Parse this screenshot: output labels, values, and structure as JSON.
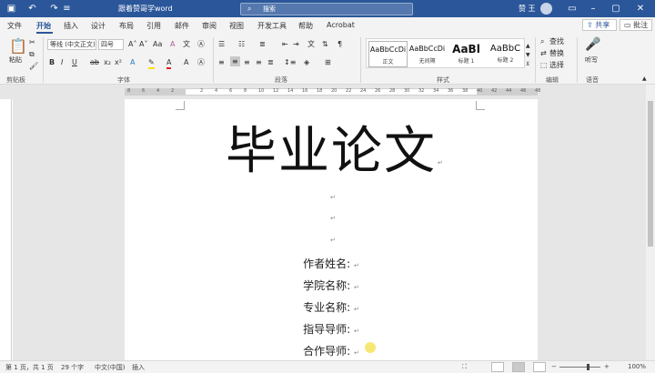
{
  "titlebar": {
    "document_title": "跟着赞哥学word",
    "search_placeholder": "搜索",
    "user_name": "赞 王"
  },
  "tabs": [
    "文件",
    "开始",
    "插入",
    "设计",
    "布局",
    "引用",
    "邮件",
    "审阅",
    "视图",
    "开发工具",
    "帮助",
    "Acrobat"
  ],
  "share_label": "共享",
  "comment_label": "批注",
  "ribbon": {
    "clipboard": {
      "paste": "粘贴",
      "group": "剪贴板"
    },
    "font": {
      "name": "等线 (中文正文)",
      "size": "四号",
      "group": "字体"
    },
    "paragraph": {
      "group": "段落"
    },
    "styles": {
      "group": "样式",
      "items": [
        {
          "preview": "AaBbCcDi",
          "name": "正文"
        },
        {
          "preview": "AaBbCcDi",
          "name": "无间隔"
        },
        {
          "preview": "AaBl",
          "name": "标题 1"
        },
        {
          "preview": "AaBbC",
          "name": "标题 2"
        }
      ]
    },
    "editing": {
      "find": "查找",
      "replace": "替换",
      "select": "选择",
      "group": "编辑"
    },
    "voice": {
      "dictate": "听写",
      "group": "语音"
    }
  },
  "ruler_numbers": [
    "8",
    "6",
    "4",
    "2",
    "",
    "2",
    "4",
    "6",
    "8",
    "10",
    "12",
    "14",
    "16",
    "18",
    "20",
    "22",
    "24",
    "26",
    "28",
    "30",
    "32",
    "34",
    "36",
    "38",
    "40",
    "42",
    "44",
    "46",
    "48"
  ],
  "document": {
    "title": "毕业论文",
    "fields": [
      "作者姓名:",
      "学院名称:",
      "专业名称:",
      "指导导师:",
      "合作导师:"
    ]
  },
  "statusbar": {
    "page": "第 1 页，共 1 页",
    "words": "29 个字",
    "language": "中文(中国)",
    "mode": "插入",
    "zoom": "100%"
  },
  "colors": {
    "accent": "#2b579a",
    "highlight": "#f4e45a"
  }
}
